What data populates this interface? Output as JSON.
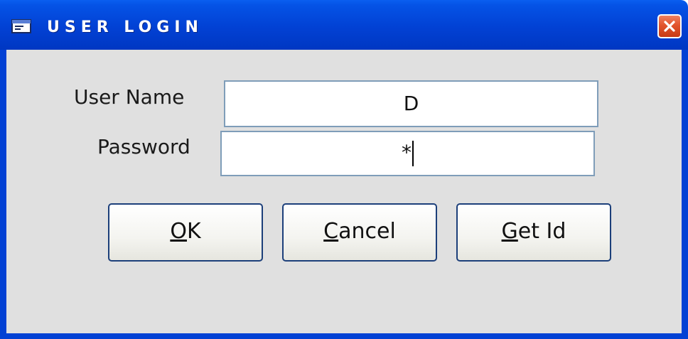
{
  "window": {
    "title": "USER LOGIN",
    "title_icon": "form-icon",
    "close_icon": "close-icon",
    "colors": {
      "titlebar": "#0241d4",
      "client": "#e0e0e0",
      "close": "#e2542c"
    }
  },
  "form": {
    "user_name_label": "User Name",
    "user_name_value": "D",
    "password_label": "Password",
    "password_value": "*"
  },
  "buttons": {
    "ok": {
      "mnemonic": "O",
      "rest": "K"
    },
    "cancel": {
      "mnemonic": "C",
      "rest": "ancel"
    },
    "get_id": {
      "mnemonic": "G",
      "rest": "et Id"
    }
  }
}
